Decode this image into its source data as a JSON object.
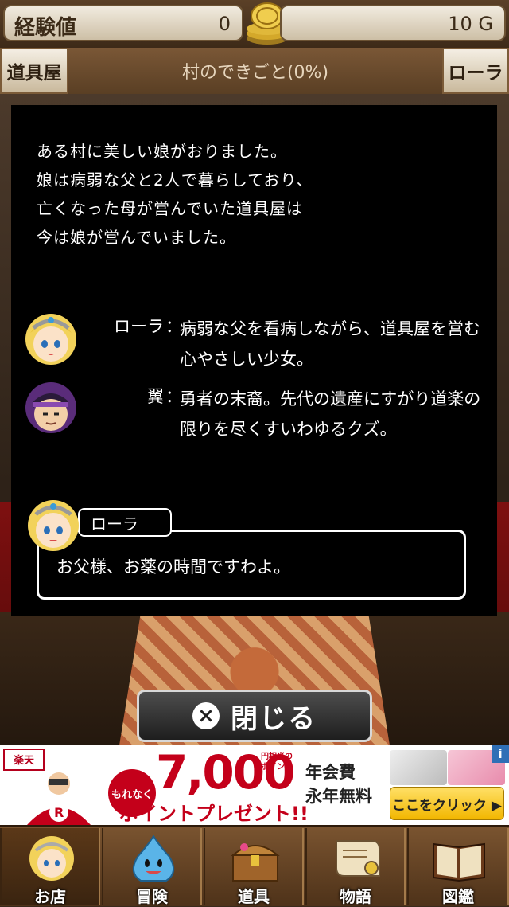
{
  "status": {
    "exp_label": "経験値",
    "exp_value": "0",
    "gold_value": "10 G"
  },
  "subbar": {
    "left_button": "道具屋",
    "title": "村のできごと(0%)",
    "right_button": "ローラ"
  },
  "story": {
    "narration": [
      "ある村に美しい娘がおりました。",
      "娘は病弱な父と2人で暮らしており、",
      "亡くなった母が営んでいた道具屋は",
      "今は娘が営んでいました。"
    ],
    "characters": [
      {
        "name": "ローラ",
        "separator": "：",
        "description": "病弱な父を看病しながら、道具屋を営む心やさしい少女。",
        "portrait": "laura-portrait-icon"
      },
      {
        "name": "翼",
        "separator": "：",
        "description": "勇者の末裔。先代の遺産にすがり道楽の限りを尽くすいわゆるクズ。",
        "portrait": "tsubasa-portrait-icon"
      }
    ],
    "speaker_name": "ローラ",
    "speech": "お父様、お薬の時間ですわよ。"
  },
  "close_button": {
    "label": "閉じる",
    "icon": "close-circle-icon"
  },
  "ad": {
    "logo": "楽天",
    "motto": "もれなく",
    "amount": "7,000",
    "units": "円相当のポイント",
    "present": "ポイントプレゼント!!",
    "fee_line1": "年会費",
    "fee_line2": "永年無料",
    "cta": "ここをクリック ▶",
    "info": "i"
  },
  "nav": [
    {
      "label": "お店",
      "icon": "shop-girl-icon",
      "active": true
    },
    {
      "label": "冒険",
      "icon": "slime-icon",
      "active": false
    },
    {
      "label": "道具",
      "icon": "treasure-chest-icon",
      "active": false
    },
    {
      "label": "物語",
      "icon": "scroll-icon",
      "active": false
    },
    {
      "label": "図鑑",
      "icon": "book-icon",
      "active": false
    }
  ],
  "colors": {
    "accent_red": "#c4001a",
    "dialog_bg": "#000000",
    "nav_brown": "#7a5430"
  }
}
